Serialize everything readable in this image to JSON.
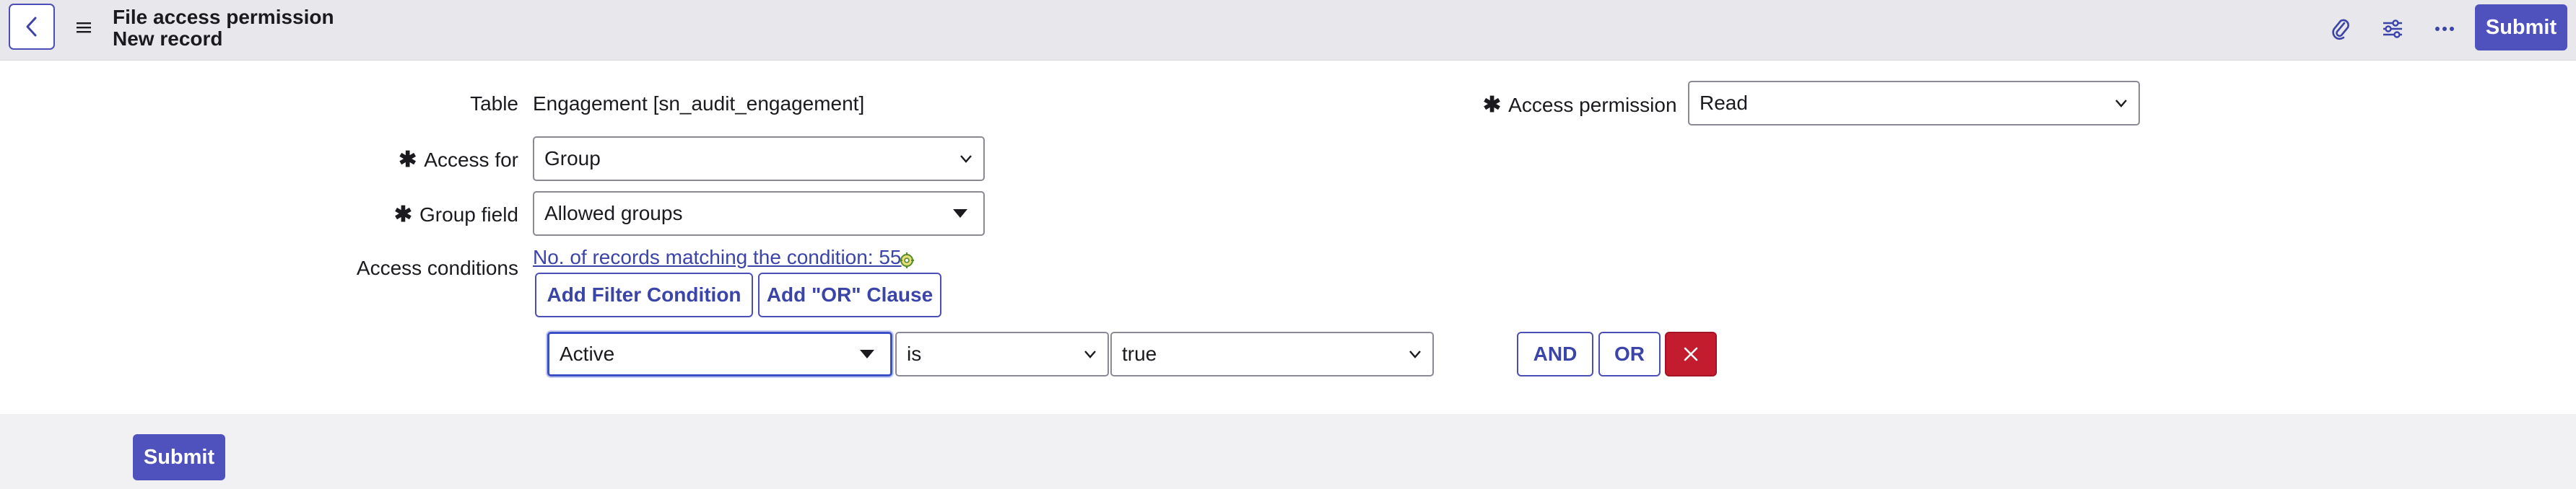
{
  "header": {
    "title": "File access permission",
    "subtitle": "New record",
    "submit_label": "Submit"
  },
  "form": {
    "table_label": "Table",
    "table_value": "Engagement [sn_audit_engagement]",
    "access_for_label": "Access for",
    "access_for_value": "Group",
    "group_field_label": "Group field",
    "group_field_value": "Allowed groups",
    "access_conditions_label": "Access conditions",
    "records_link": "No. of records matching the condition: 55",
    "add_filter_label": "Add Filter Condition",
    "add_or_label": "Add \"OR\" Clause",
    "condition": {
      "field": "Active",
      "operator": "is",
      "value": "true",
      "and_label": "AND",
      "or_label": "OR"
    },
    "access_permission_label": "Access permission",
    "access_permission_value": "Read"
  },
  "footer": {
    "submit_label": "Submit"
  },
  "colors": {
    "accent": "#4f52bd",
    "danger": "#c41c2f",
    "link": "#3b44a8"
  }
}
